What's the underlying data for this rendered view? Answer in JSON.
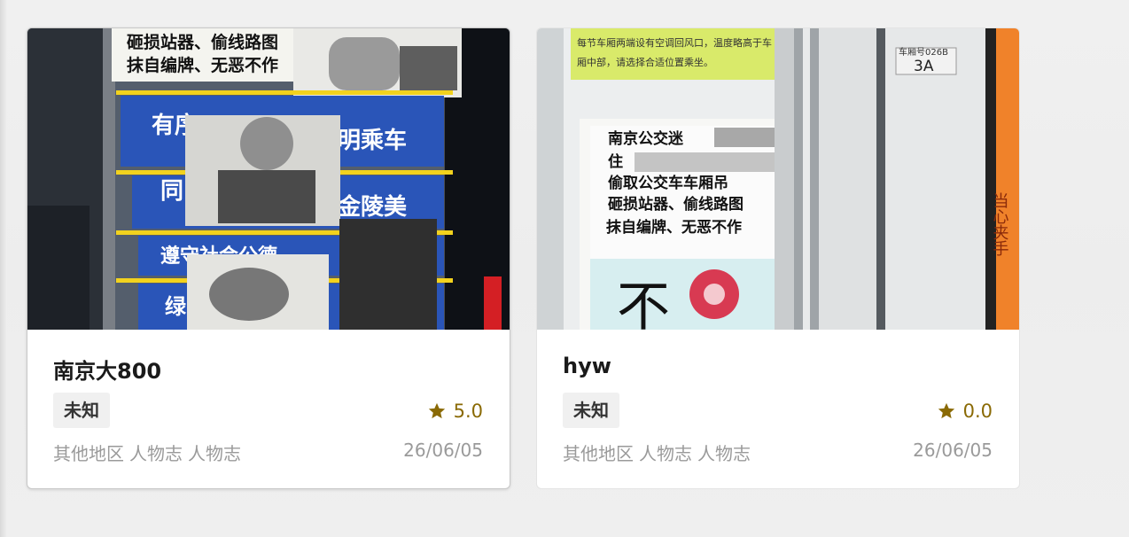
{
  "cards": [
    {
      "title": "南京大800",
      "tag": "未知",
      "rating": "5.0",
      "meta": [
        "其他地区",
        "人物志",
        "人物志"
      ],
      "date": "26/06/05",
      "image": {
        "poster_line_1": "砸损站器、偷线路图",
        "poster_line_2": "抹自编牌、无恶不作",
        "sign_1": "有序",
        "sign_1b": "明乘车",
        "sign_2": "同",
        "sign_2b": "金陵美",
        "sign_3": "遵守社会公德",
        "sign_4": "绿"
      },
      "colors": {
        "star": "#8a6a05",
        "sign_blue": "#2a55b8",
        "sign_yellow": "#f2d21e"
      }
    },
    {
      "title": "hyw",
      "tag": "未知",
      "rating": "0.0",
      "meta": [
        "其他地区",
        "人物志",
        "人物志"
      ],
      "date": "26/06/05",
      "image": {
        "banner_line_1": "每节车厢两端设有空调回风口，温度略高于车",
        "banner_line_2": "厢中部，请选择合适位置乘坐。",
        "car_no_label": "车厢号026B",
        "car_no": "3A",
        "notice_line_1": "南京公交迷",
        "notice_line_2": "住",
        "notice_line_3": "偷取公交车车厢吊",
        "notice_line_4": "砸损站器、偷线路图",
        "notice_line_5": "抹自编牌、无恶不作",
        "big_char": "不",
        "side_text": "当心夹手"
      },
      "colors": {
        "star": "#8a6a05",
        "banner": "#d9ea6a",
        "side_orange": "#f0822a"
      }
    }
  ]
}
